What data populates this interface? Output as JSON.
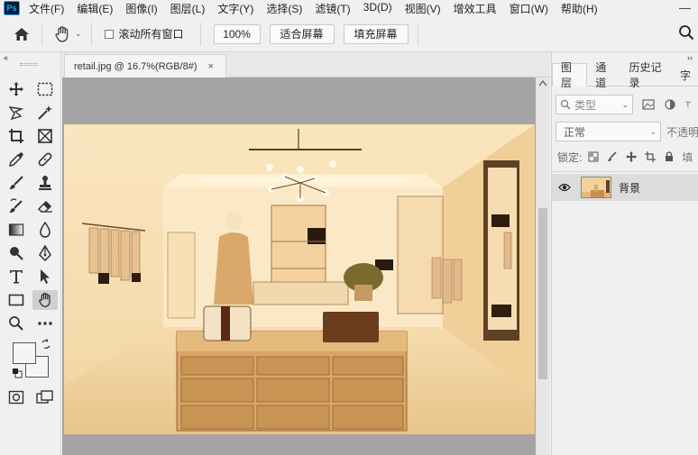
{
  "app": {
    "logo": "Ps"
  },
  "menu": [
    "文件(F)",
    "编辑(E)",
    "图像(I)",
    "图层(L)",
    "文字(Y)",
    "选择(S)",
    "滤镜(T)",
    "3D(D)",
    "视图(V)",
    "增效工具",
    "窗口(W)",
    "帮助(H)"
  ],
  "window_controls": {
    "minimize": "—"
  },
  "options": {
    "scroll_all_windows": "滚动所有窗口",
    "scroll_all_checked": false,
    "zoom_100": "100%",
    "fit_screen": "适合屏幕",
    "fill_screen": "填充屏幕"
  },
  "toolbar": {
    "collapse": "‹‹",
    "active_tool": "hand-icon",
    "tools": [
      "move-icon",
      "rect-marquee-icon",
      "lasso-icon",
      "magic-wand-icon",
      "crop-icon",
      "frame-icon",
      "eyedropper-icon",
      "healing-brush-icon",
      "brush-icon",
      "stamp-icon",
      "history-brush-icon",
      "eraser-icon",
      "gradient-icon",
      "blur-icon",
      "dodge-icon",
      "pen-icon",
      "type-icon",
      "path-select-icon",
      "rectangle-icon",
      "hand-icon",
      "zoom-icon",
      "more-icon",
      "quick-mask-icon",
      "screen-mode-icon"
    ],
    "foreground_color": "#f5f5f5",
    "background_color": "#f5f5f5"
  },
  "document": {
    "tab_title": "retail.jpg @ 16.7%(RGB/8#)",
    "close": "×"
  },
  "panels": {
    "collapse": "››",
    "tabs": [
      "图层",
      "通道",
      "历史记录",
      "字"
    ],
    "active_tab": "图层",
    "filter_kind": "类型",
    "blend_mode": "正常",
    "opacity_label": "不透明",
    "lock_label": "锁定:",
    "fill_label": "填",
    "layers": [
      {
        "name": "背景",
        "visible": true
      }
    ]
  },
  "colors": {
    "ps_blue": "#31a8ff",
    "ps_dark": "#001e36",
    "canvas_bg": "#a4a4a4",
    "panel_bg": "#f0f0f0",
    "layer_selected": "#dcdcdc"
  }
}
